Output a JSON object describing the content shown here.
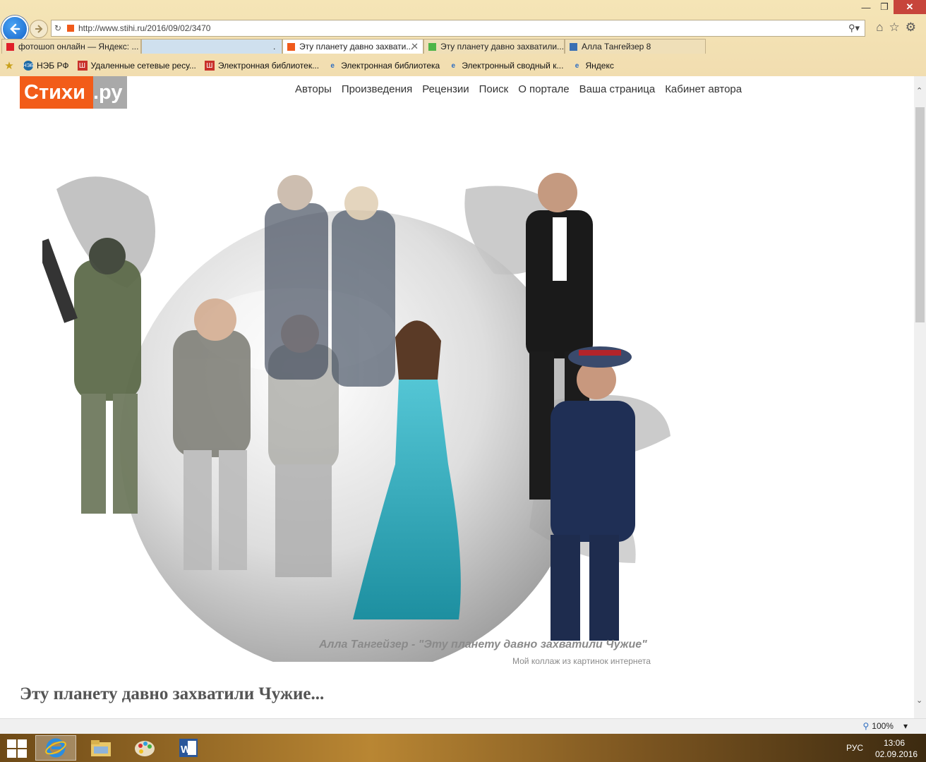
{
  "browser": {
    "url": "http://www.stihi.ru/2016/09/02/3470",
    "tabs": [
      {
        "label": "фотошоп онлайн — Яндекс: ...",
        "active": false,
        "color": "#e0202a"
      },
      {
        "label": ".",
        "active": false,
        "color": "#8db7d8"
      },
      {
        "label": "Эту планету давно захвати...",
        "active": true,
        "color": "#f05a1b"
      },
      {
        "label": "Эту планету давно захватили.....",
        "active": false,
        "color": "#4fb548"
      },
      {
        "label": "Алла Тангейзер 8",
        "active": false,
        "color": "#3a6fb3"
      }
    ],
    "favorites": [
      {
        "label": "НЭБ РФ",
        "icon": "neb-icon"
      },
      {
        "label": "Удаленные сетевые ресу...",
        "icon": "library-icon"
      },
      {
        "label": "Электронная библиотек...",
        "icon": "library-icon"
      },
      {
        "label": "Электронная библиотека",
        "icon": "ie-page-icon"
      },
      {
        "label": "Электронный сводный к...",
        "icon": "ie-page-icon"
      },
      {
        "label": "Яндекс",
        "icon": "ie-page-icon"
      }
    ],
    "zoom": "100%"
  },
  "site": {
    "logo_main": "Стихи",
    "logo_suffix": ".ру",
    "nav": [
      "Авторы",
      "Произведения",
      "Рецензии",
      "Поиск",
      "О портале",
      "Ваша страница",
      "Кабинет автора"
    ],
    "caption_title": "Алла Тангейзер - \"Эту планету давно захватили Чужие\"",
    "caption_sub": "Мой коллаж из картинок интернета",
    "poem_title": "Эту планету давно захватили Чужие..."
  },
  "taskbar": {
    "lang": "РУС",
    "time": "13:06",
    "date": "02.09.2016"
  }
}
